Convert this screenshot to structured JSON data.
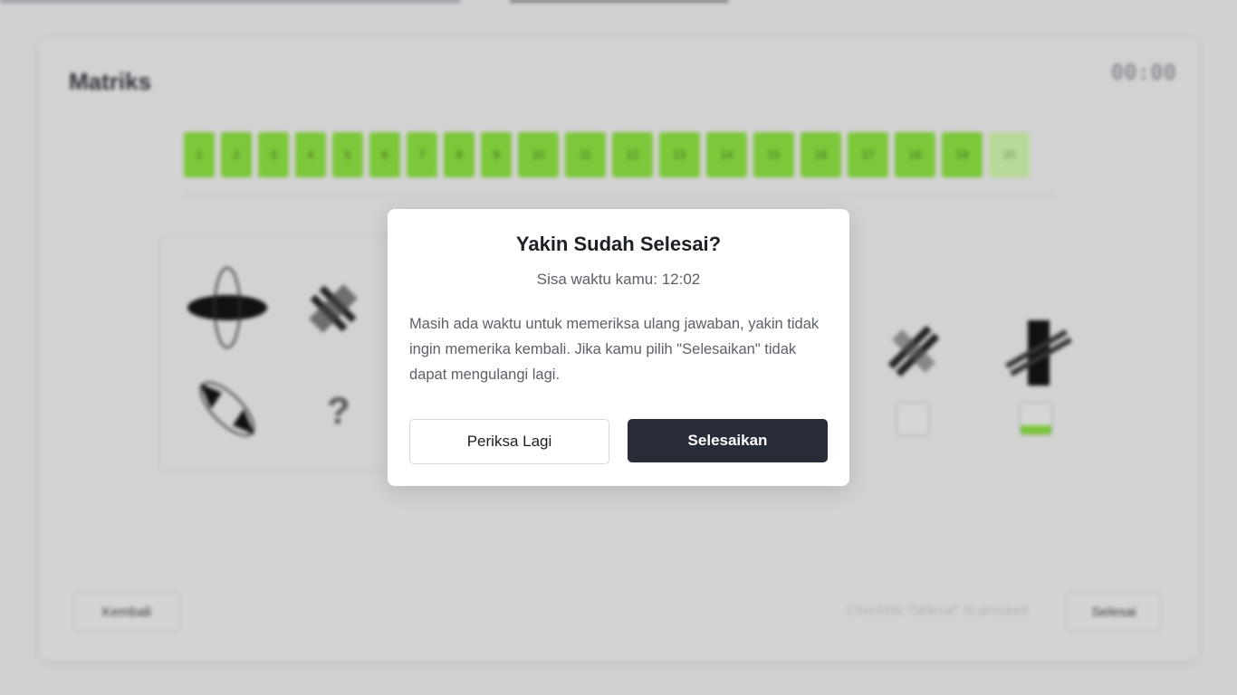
{
  "page": {
    "title": "Matriks",
    "timer": "00:00"
  },
  "question_nav": {
    "numbers": [
      "1",
      "2",
      "3",
      "4",
      "5",
      "6",
      "7",
      "8",
      "9",
      "10",
      "11",
      "12",
      "13",
      "14",
      "15",
      "16",
      "17",
      "18",
      "19",
      "20"
    ],
    "current": "20",
    "answered_color": "#7cc73a"
  },
  "matrix": {
    "missing_symbol": "?"
  },
  "footer": {
    "back_label": "Kembali",
    "hint": "Checklist \"Selesai\" to proceed",
    "finish_label": "Selesai"
  },
  "modal": {
    "title": "Yakin Sudah Selesai?",
    "remaining_prefix": "Sisa waktu kamu:",
    "remaining_time": "12:02",
    "body": "Masih ada waktu untuk memeriksa ulang jawaban, yakin tidak ingin memerika kembali. Jika kamu pilih \"Selesaikan\" tidak dapat mengulangi lagi.",
    "check_again_label": "Periksa Lagi",
    "finish_label": "Selesaikan"
  },
  "colors": {
    "primary_button": "#272c38",
    "overlay": "#cfd0d2"
  }
}
